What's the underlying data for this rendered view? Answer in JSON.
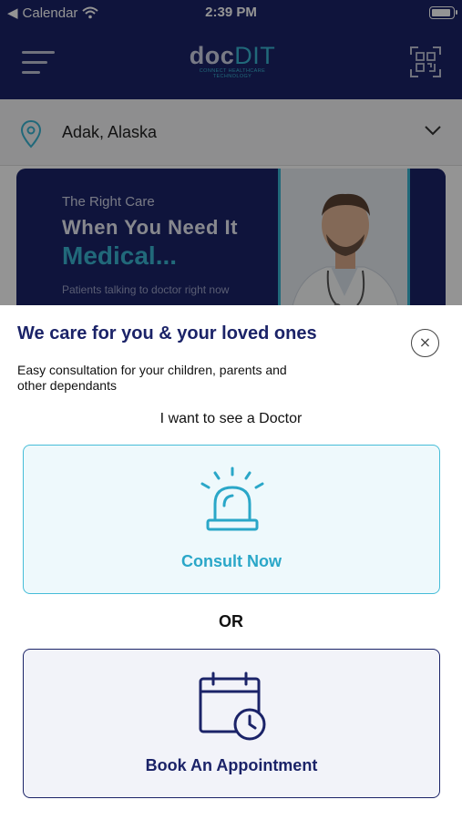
{
  "status_bar": {
    "back_app": "Calendar",
    "time": "2:39 PM"
  },
  "header": {
    "logo_main": "doc",
    "logo_accent": "DIT",
    "logo_tagline": "CONNECT HEALTHCARE TECHNOLOGY"
  },
  "location": {
    "value": "Adak, Alaska"
  },
  "banner": {
    "line1": "The Right Care",
    "line2": "When You Need It",
    "line3": "Medical...",
    "line4": "Patients talking to doctor right now"
  },
  "sheet": {
    "title": "We care for you & your loved ones",
    "close_icon": "×",
    "description": "Easy consultation for your children, parents and other dependants",
    "prompt": "I want to see a Doctor",
    "consult_label": "Consult Now",
    "or_label": "OR",
    "book_label": "Book An Appointment"
  },
  "colors": {
    "navy": "#1b2368",
    "accent": "#39b5d3",
    "consult_bg": "#eef9fc"
  }
}
